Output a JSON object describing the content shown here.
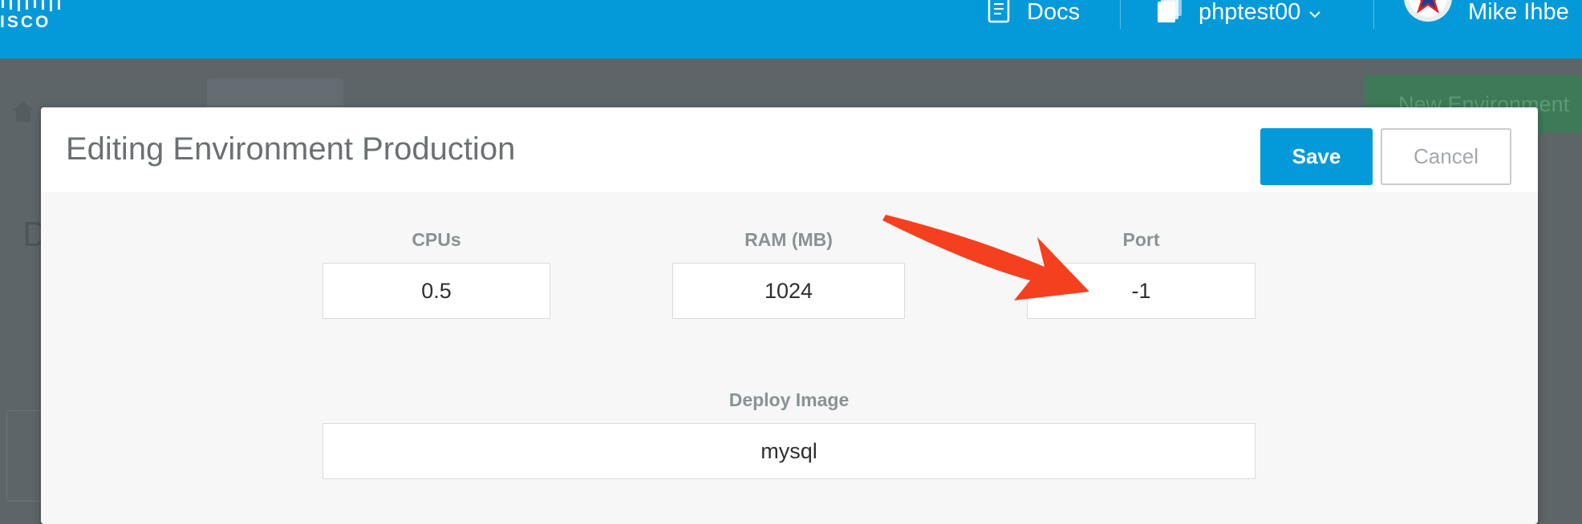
{
  "topbar": {
    "logo_text": "ISCO",
    "docs_label": "Docs",
    "project_label": "phptest00",
    "user_name": "Mike Ihbe"
  },
  "background_page": {
    "new_environment_label": "New Environment",
    "heading_fragment": "D"
  },
  "modal": {
    "title": "Editing Environment Production",
    "save_label": "Save",
    "cancel_label": "Cancel",
    "fields": {
      "cpus": {
        "label": "CPUs",
        "value": "0.5"
      },
      "ram": {
        "label": "RAM (MB)",
        "value": "1024"
      },
      "port": {
        "label": "Port",
        "value": "-1"
      },
      "deploy_image": {
        "label": "Deploy Image",
        "value": "mysql"
      }
    }
  },
  "colors": {
    "brand_blue": "#049ad9",
    "overlay": "#5d6569",
    "annotation_arrow": "#f4401e"
  },
  "icons": {
    "docs": "document-icon",
    "project": "stacked-pages-icon",
    "user": "star-avatar-icon"
  }
}
